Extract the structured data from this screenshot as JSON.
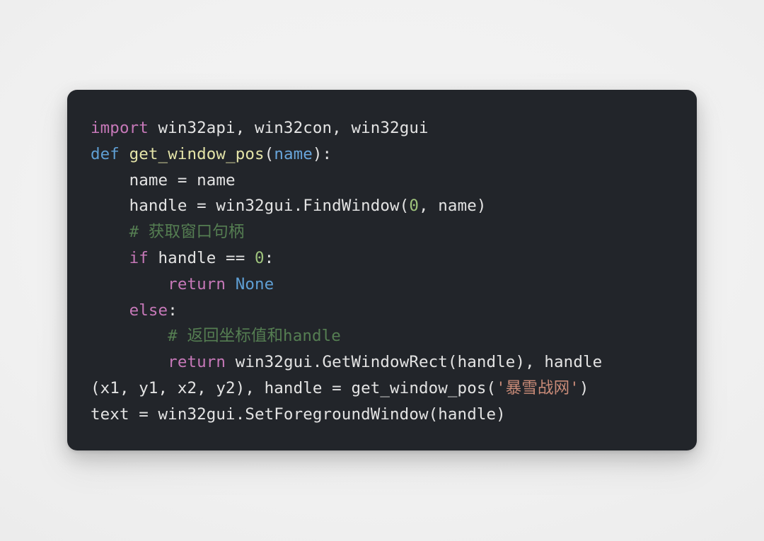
{
  "editor": {
    "kind": "code-snippet-card",
    "language": "python",
    "background_color": "#f1f1f1",
    "card_color": "#22252a",
    "theme_colors": {
      "plain": "#e3e3e3",
      "keyword": "#c678b8",
      "def_keyword": "#5f9fd4",
      "builtin": "#5f9fd4",
      "function_name": "#e4e4a8",
      "parameter": "#68a5db",
      "number": "#9ec37c",
      "comment": "#557e52",
      "string": "#c98b78"
    },
    "plain_text": "import win32api, win32con, win32gui\ndef get_window_pos(name):\n    name = name\n    handle = win32gui.FindWindow(0, name)\n    # 获取窗口句柄\n    if handle == 0:\n        return None\n    else:\n        # 返回坐标值和handle\n        return win32gui.GetWindowRect(handle), handle\n(x1, y1, x2, y2), handle = get_window_pos('暴雪战网')\ntext = win32gui.SetForegroundWindow(handle)",
    "lines": [
      {
        "id": "line-1",
        "tokens": [
          {
            "text": "import",
            "type": "kw"
          },
          {
            "text": " win32api, win32con, win32gui",
            "type": "plain"
          }
        ]
      },
      {
        "id": "line-2",
        "tokens": [
          {
            "text": "def",
            "type": "def"
          },
          {
            "text": " ",
            "type": "plain"
          },
          {
            "text": "get_window_pos",
            "type": "fn"
          },
          {
            "text": "(",
            "type": "punc"
          },
          {
            "text": "name",
            "type": "param"
          },
          {
            "text": "):",
            "type": "punc"
          }
        ]
      },
      {
        "id": "line-3",
        "tokens": [
          {
            "text": "    name = name",
            "type": "plain"
          }
        ]
      },
      {
        "id": "line-4",
        "tokens": [
          {
            "text": "    handle = win32gui.FindWindow(",
            "type": "plain"
          },
          {
            "text": "0",
            "type": "num"
          },
          {
            "text": ", name)",
            "type": "plain"
          }
        ]
      },
      {
        "id": "line-5",
        "tokens": [
          {
            "text": "    # 获取窗口句柄",
            "type": "comment"
          }
        ]
      },
      {
        "id": "line-6",
        "tokens": [
          {
            "text": "    ",
            "type": "plain"
          },
          {
            "text": "if",
            "type": "kw"
          },
          {
            "text": " handle == ",
            "type": "plain"
          },
          {
            "text": "0",
            "type": "num"
          },
          {
            "text": ":",
            "type": "plain"
          }
        ]
      },
      {
        "id": "line-7",
        "tokens": [
          {
            "text": "        ",
            "type": "plain"
          },
          {
            "text": "return",
            "type": "kw"
          },
          {
            "text": " ",
            "type": "plain"
          },
          {
            "text": "None",
            "type": "builtin"
          }
        ]
      },
      {
        "id": "line-8",
        "tokens": [
          {
            "text": "    ",
            "type": "plain"
          },
          {
            "text": "else",
            "type": "kw"
          },
          {
            "text": ":",
            "type": "plain"
          }
        ]
      },
      {
        "id": "line-9",
        "tokens": [
          {
            "text": "        # 返回坐标值和handle",
            "type": "comment"
          }
        ]
      },
      {
        "id": "line-10",
        "tokens": [
          {
            "text": "        ",
            "type": "plain"
          },
          {
            "text": "return",
            "type": "kw"
          },
          {
            "text": " win32gui.GetWindowRect(handle), handle",
            "type": "plain"
          }
        ]
      },
      {
        "id": "line-11",
        "tokens": [
          {
            "text": "(x1, y1, x2, y2), handle = get_window_pos(",
            "type": "plain"
          },
          {
            "text": "'暴雪战网'",
            "type": "str"
          },
          {
            "text": ")",
            "type": "plain"
          }
        ]
      },
      {
        "id": "line-12",
        "tokens": [
          {
            "text": "text = win32gui.SetForegroundWindow(handle)",
            "type": "plain"
          }
        ]
      }
    ]
  }
}
